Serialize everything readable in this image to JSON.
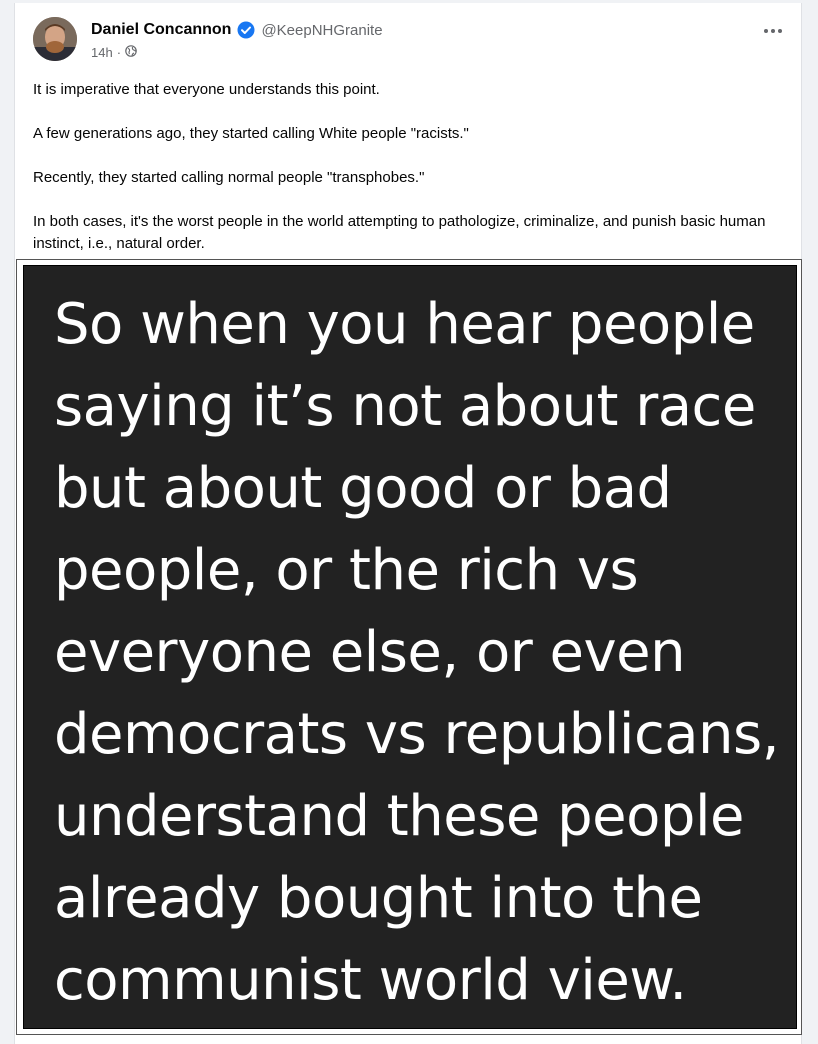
{
  "post": {
    "author_name": "Daniel Concannon",
    "author_handle": "@KeepNHGranite",
    "timestamp": "14h",
    "separator": "·",
    "privacy_icon": "public-globe-icon",
    "verified_icon": "verified-badge-icon",
    "more_icon": "more-options-icon",
    "paragraphs": [
      "It is imperative that everyone understands this point.",
      "A few generations ago, they started calling White people \"racists.\"",
      "Recently, they started calling normal people \"transphobes.\"",
      "In both cases, it's the worst people in the world attempting to pathologize, criminalize, and punish basic human instinct, i.e., natural order."
    ],
    "image_text": "So when you hear people\nsaying it’s not about race\nbut about good or bad\npeople, or the rich vs\neveryone else, or even\ndemocrats vs republicans,\nunderstand these people\nalready bought into the\ncommunist world view."
  },
  "colors": {
    "verified": "#1877f2",
    "image_bg": "#222222",
    "image_text": "#ffffff"
  }
}
